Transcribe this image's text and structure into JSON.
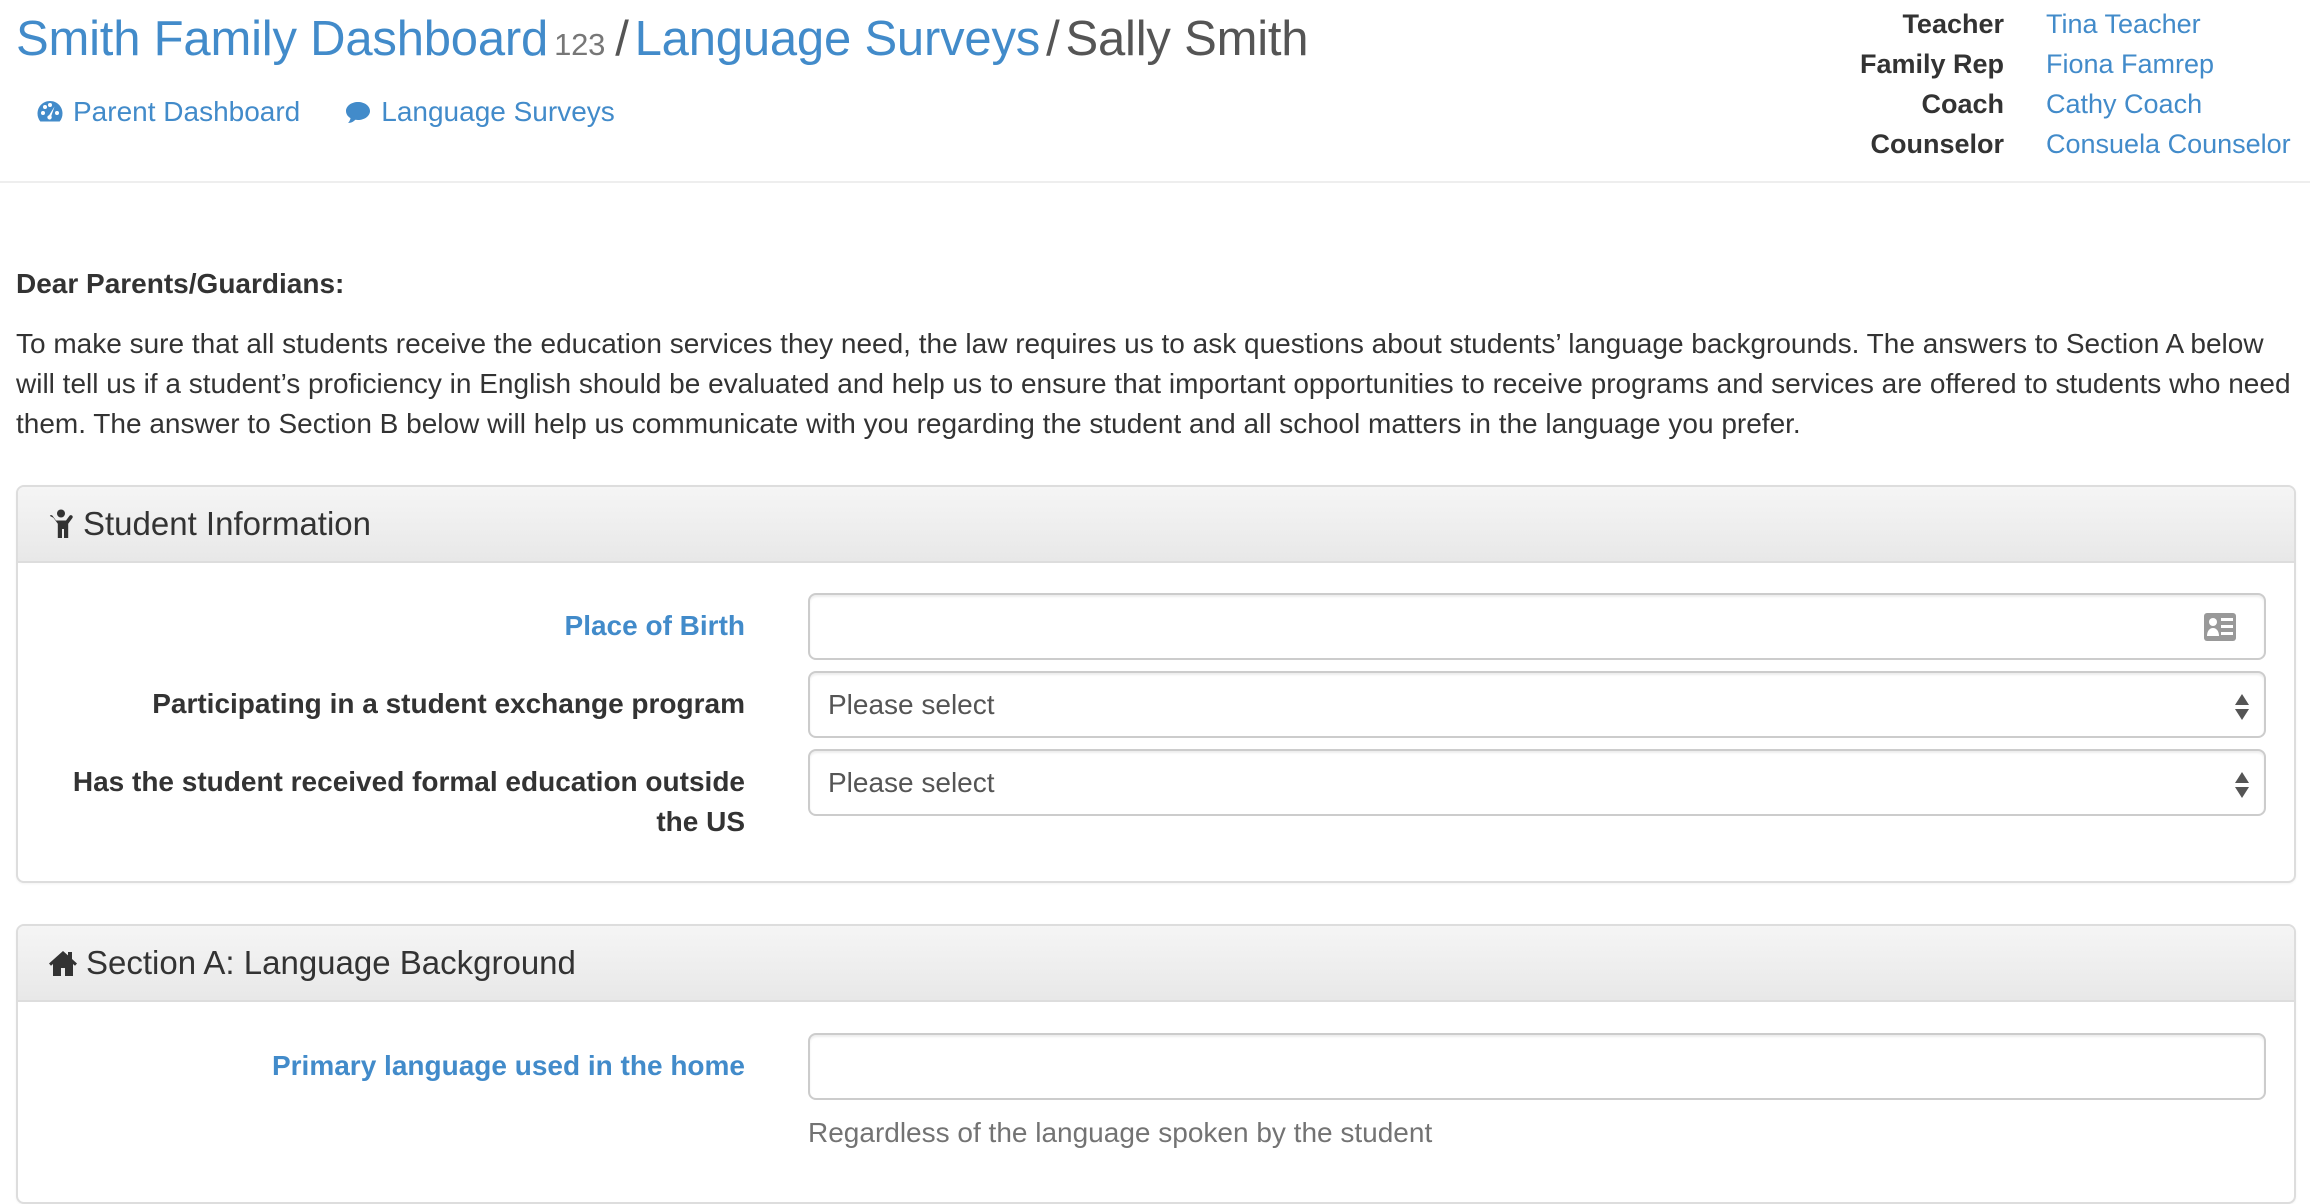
{
  "header": {
    "breadcrumb": {
      "family": "Smith Family Dashboard",
      "family_id": "123",
      "separator": "/",
      "section": "Language Surveys",
      "current": "Sally Smith"
    },
    "subnav": [
      {
        "label": "Parent Dashboard",
        "icon": "dashboard-icon"
      },
      {
        "label": "Language Surveys",
        "icon": "comment-icon"
      }
    ],
    "staff": [
      {
        "role": "Teacher",
        "name": "Tina Teacher"
      },
      {
        "role": "Family Rep",
        "name": "Fiona Famrep"
      },
      {
        "role": "Coach",
        "name": "Cathy Coach"
      },
      {
        "role": "Counselor",
        "name": "Consuela Counselor"
      }
    ]
  },
  "intro": {
    "greeting": "Dear Parents/Guardians:",
    "body": "To make sure that all students receive the education services they need, the law requires us to ask questions about students’ language backgrounds. The answers to Section A below will tell us if a student’s proficiency in English should be evaluated and help us to ensure that important opportunities to receive programs and services are offered to students who need them. The answer to Section B below will help us communicate with you regarding the student and all school matters in the language you prefer."
  },
  "student_info": {
    "title": "Student Information",
    "icon": "child-icon",
    "fields": [
      {
        "label": "Place of Birth",
        "type": "text",
        "value": "",
        "icon": "vcard-icon"
      },
      {
        "label": "Participating in a student exchange program",
        "type": "select",
        "value": "Please select"
      },
      {
        "label": "Has the student received formal education outside the US",
        "type": "select",
        "value": "Please select"
      }
    ]
  },
  "section_a": {
    "title": "Section A: Language Background",
    "icon": "home-icon",
    "fields": [
      {
        "label": "Primary language used in the home",
        "type": "text",
        "value": "",
        "help": "Regardless of the language spoken by the student"
      }
    ]
  },
  "colors": {
    "link": "#428bca",
    "text": "#333333",
    "muted": "#737373",
    "border": "#dddddd"
  }
}
